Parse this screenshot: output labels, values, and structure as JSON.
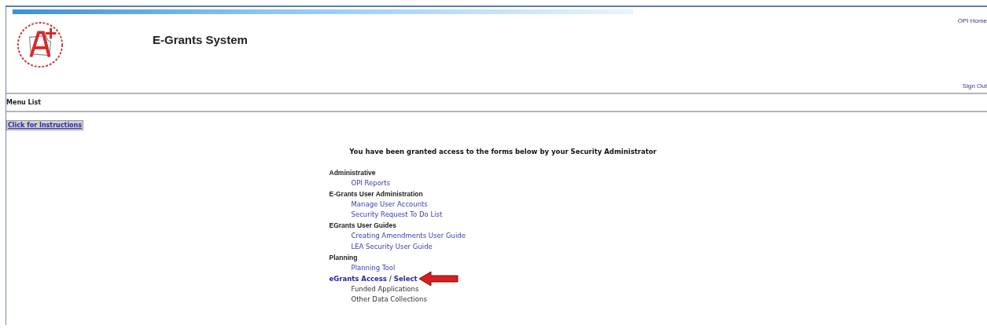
{
  "header": {
    "title": "E-Grants System",
    "links": [
      {
        "label": "OPI Home"
      },
      {
        "label": "Sign Out"
      }
    ]
  },
  "menu_bar": {
    "title": "Menu List"
  },
  "instructions_button": {
    "label": "Click for Instructions"
  },
  "intro": "You have been granted access to the forms below by your Security Administrator",
  "groups": [
    {
      "label": "Administrative",
      "kind": "heading",
      "arrow": false,
      "children": [
        {
          "label": "OPI Reports",
          "kind": "link"
        }
      ]
    },
    {
      "label": "E-Grants User Administration",
      "kind": "heading",
      "arrow": false,
      "children": [
        {
          "label": "Manage User Accounts",
          "kind": "link"
        },
        {
          "label": "Security Request To Do List",
          "kind": "link"
        }
      ]
    },
    {
      "label": "EGrants User Guides",
      "kind": "heading",
      "arrow": false,
      "children": [
        {
          "label": "Creating Amendments User Guide",
          "kind": "link"
        },
        {
          "label": "LEA Security User Guide",
          "kind": "link"
        }
      ]
    },
    {
      "label": "Planning",
      "kind": "heading",
      "arrow": false,
      "children": [
        {
          "label": "Planning Tool",
          "kind": "link"
        }
      ]
    },
    {
      "label": "eGrants Access / Select",
      "kind": "link",
      "arrow": true,
      "children": [
        {
          "label": "Funded Applications",
          "kind": "text"
        },
        {
          "label": "Other Data Collections",
          "kind": "text"
        }
      ]
    }
  ]
}
